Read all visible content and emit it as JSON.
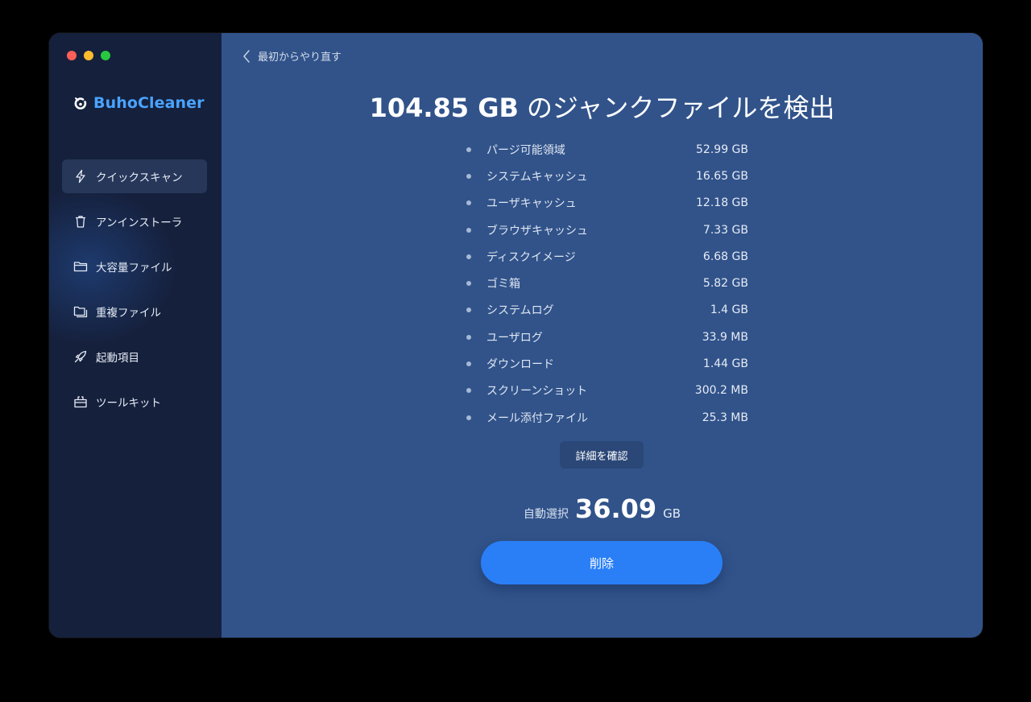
{
  "app": {
    "brand": "BuhoCleaner",
    "colors": {
      "accent": "#2a7ff7",
      "brand": "#4aa3ff",
      "sidebar": "#15203c",
      "main": "#31538a"
    }
  },
  "window_controls": [
    "close",
    "minimize",
    "zoom"
  ],
  "sidebar": {
    "items": [
      {
        "label": "クイックスキャン",
        "icon": "lightning-icon",
        "active": true
      },
      {
        "label": "アンインストーラ",
        "icon": "trash-icon",
        "active": false
      },
      {
        "label": "大容量ファイル",
        "icon": "folder-icon",
        "active": false
      },
      {
        "label": "重複ファイル",
        "icon": "duplicate-folder-icon",
        "active": false
      },
      {
        "label": "起動項目",
        "icon": "rocket-icon",
        "active": false
      },
      {
        "label": "ツールキット",
        "icon": "toolbox-icon",
        "active": false
      }
    ]
  },
  "main": {
    "back_label": "最初からやり直す",
    "title_number": "104.85 GB",
    "title_text": "のジャンクファイルを検出",
    "items": [
      {
        "label": "パージ可能領域",
        "size": "52.99 GB"
      },
      {
        "label": "システムキャッシュ",
        "size": "16.65 GB"
      },
      {
        "label": "ユーザキャッシュ",
        "size": "12.18 GB"
      },
      {
        "label": "ブラウザキャッシュ",
        "size": "7.33 GB"
      },
      {
        "label": "ディスクイメージ",
        "size": "6.68 GB"
      },
      {
        "label": "ゴミ箱",
        "size": "5.82 GB"
      },
      {
        "label": "システムログ",
        "size": "1.4 GB"
      },
      {
        "label": "ユーザログ",
        "size": "33.9 MB"
      },
      {
        "label": "ダウンロード",
        "size": "1.44 GB"
      },
      {
        "label": "スクリーンショット",
        "size": "300.2 MB"
      },
      {
        "label": "メール添付ファイル",
        "size": "25.3 MB"
      }
    ],
    "details_label": "詳細を確認",
    "auto_select_label": "自動選択",
    "auto_select_value": "36.09",
    "auto_select_unit": "GB",
    "delete_label": "削除"
  }
}
